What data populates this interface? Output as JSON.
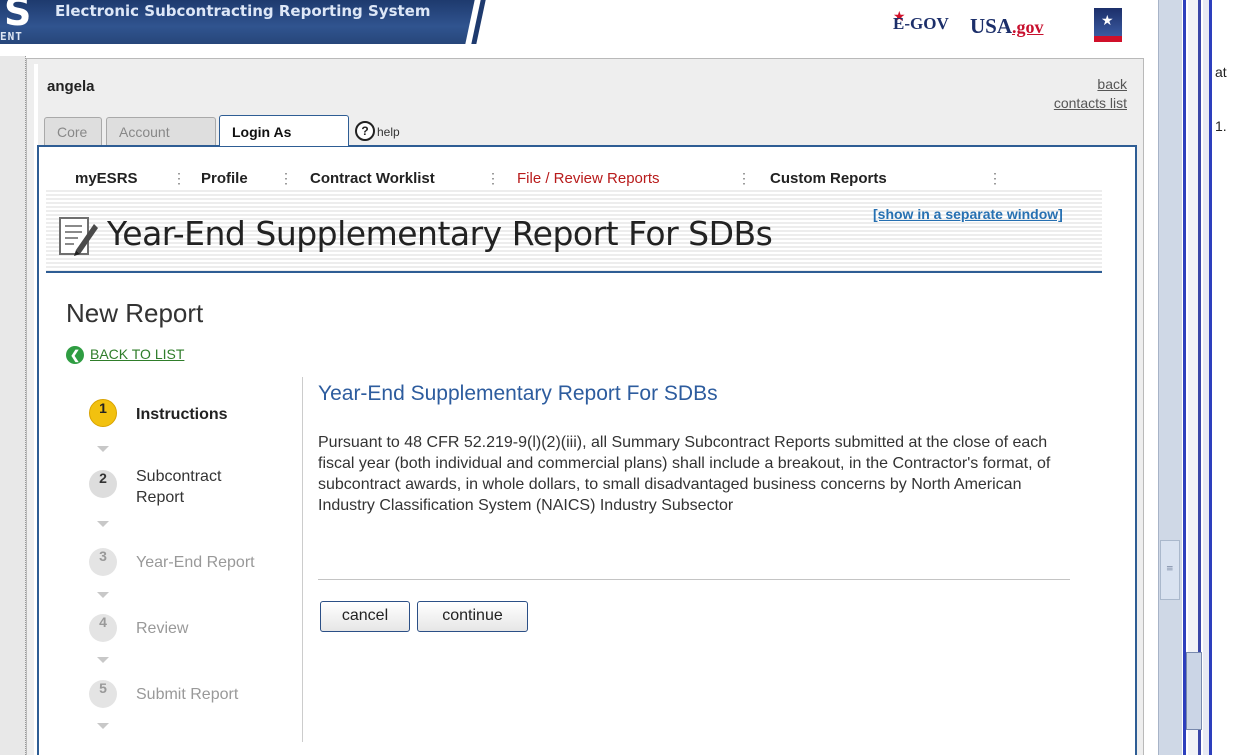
{
  "banner": {
    "logo_fragment": "S",
    "ent_fragment": "ENT",
    "title": "Electronic Subcontracting Reporting System",
    "egov": "E-GOV",
    "usagov_main": "USA",
    "usagov_suffix": ".gov"
  },
  "user": {
    "name": "angela",
    "back": "back",
    "contacts": "contacts list"
  },
  "tabs": {
    "core": "Core",
    "account": "Account",
    "login_as": "Login As",
    "help": "help"
  },
  "nav": {
    "myesrs": "myESRS",
    "profile": "Profile",
    "worklist": "Contract Worklist",
    "file_review": "File / Review Reports",
    "custom": "Custom Reports"
  },
  "header": {
    "page_title": "Year-End Supplementary Report For SDBs",
    "separate_window": "[show in a separate window]"
  },
  "content": {
    "heading": "New Report",
    "back_to_list": "BACK TO LIST",
    "section_title": "Year-End Supplementary Report For SDBs",
    "body": "Pursuant to 48 CFR 52.219-9(l)(2)(iii), all Summary Subcontract Reports submitted at the close of each fiscal year (both individual and commercial plans) shall include a breakout, in the Contractor's format, of subcontract awards, in whole dollars, to small disadvantaged business concerns by North American Industry Classification System (NAICS) Industry Subsector",
    "cancel": "cancel",
    "continue": "continue"
  },
  "steps": [
    {
      "num": "1",
      "label_line1": "Instructions",
      "label_line2": "",
      "state": "active"
    },
    {
      "num": "2",
      "label_line1": "Subcontract",
      "label_line2": "Report",
      "state": "done"
    },
    {
      "num": "3",
      "label_line1": "Year-End Report",
      "label_line2": "",
      "state": "muted"
    },
    {
      "num": "4",
      "label_line1": "Review",
      "label_line2": "",
      "state": "muted"
    },
    {
      "num": "5",
      "label_line1": "Submit Report",
      "label_line2": "",
      "state": "muted"
    }
  ],
  "right_fragments": {
    "top": "at",
    "mid": "1."
  },
  "colors": {
    "banner_blue": "#1e3a6e",
    "panel_border": "#2e5d94",
    "active_nav": "#b81b1b",
    "step_active": "#f2c10f",
    "section_title": "#2d5c9e"
  }
}
